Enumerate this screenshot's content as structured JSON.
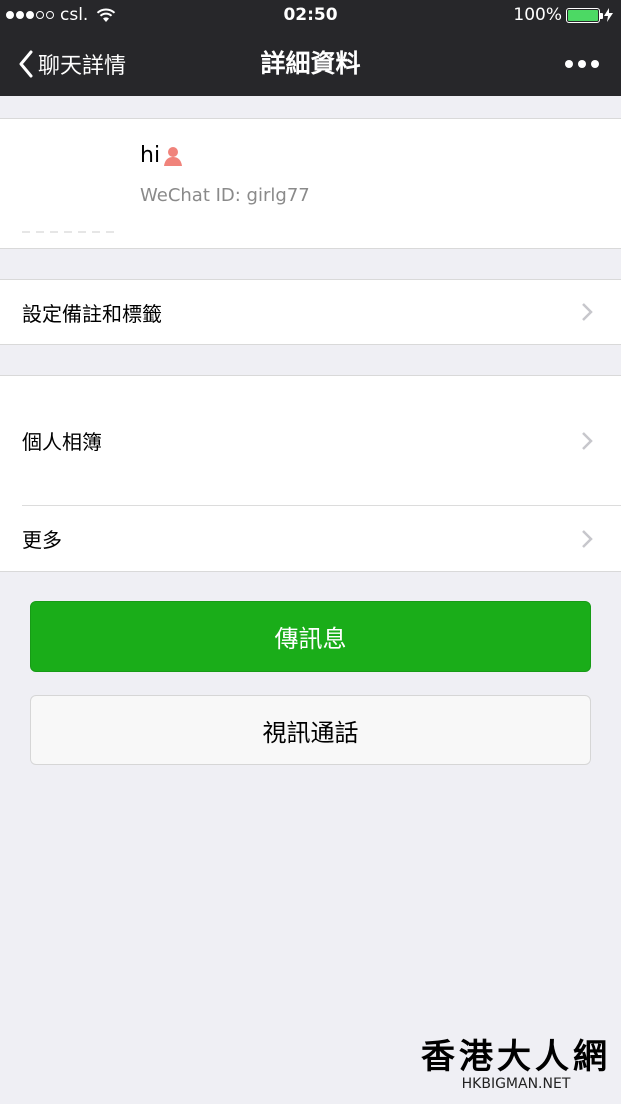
{
  "status_bar": {
    "carrier": "csl.",
    "time": "02:50",
    "battery": "100%"
  },
  "nav": {
    "back_label": "聊天詳情",
    "title": "詳細資料"
  },
  "profile": {
    "name": "hi",
    "wechat_id": "WeChat ID: girlg77"
  },
  "menu": {
    "remark_label": "設定備註和標籤",
    "album_label": "個人相簿",
    "more_label": "更多"
  },
  "buttons": {
    "message": "傳訊息",
    "video_call": "視訊通話"
  },
  "watermark": {
    "chinese": "香港大人網",
    "english": "HKBIGMAN.NET"
  },
  "colors": {
    "accent_green": "#1aad19",
    "nav_background": "#27272a",
    "page_background": "#efeff4"
  }
}
